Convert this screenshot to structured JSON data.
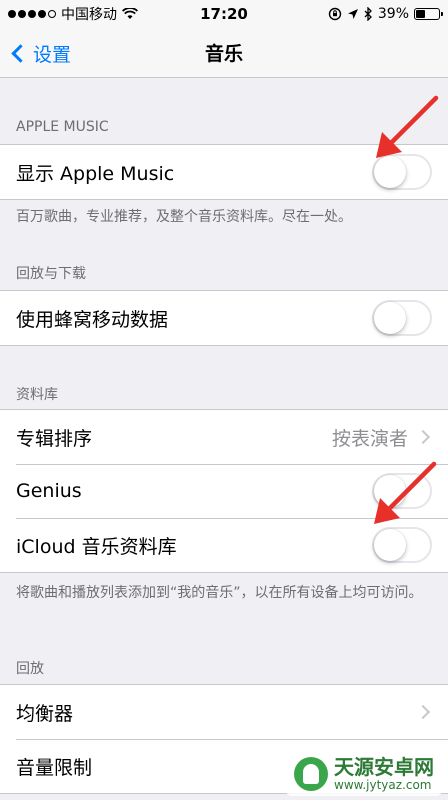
{
  "status_bar": {
    "carrier": "中国移动",
    "time": "17:20",
    "battery_percent": "39%",
    "battery_level": 0.39,
    "icons": [
      "signal-dots-icon",
      "wifi-icon",
      "rotation-lock-icon",
      "location-icon",
      "bluetooth-icon",
      "battery-icon"
    ]
  },
  "nav": {
    "back_label": "设置",
    "title": "音乐"
  },
  "sections": {
    "apple_music": {
      "header": "APPLE MUSIC",
      "show_apple_music": {
        "label": "显示 Apple Music",
        "on": false
      },
      "footer": "百万歌曲，专业推荐，及整个音乐资料库。尽在一处。"
    },
    "playback_download": {
      "header": "回放与下载",
      "cellular": {
        "label": "使用蜂窝移动数据",
        "on": false
      }
    },
    "library": {
      "header": "资料库",
      "sort_albums": {
        "label": "专辑排序",
        "value": "按表演者"
      },
      "genius": {
        "label": "Genius",
        "on": false
      },
      "icloud_library": {
        "label": "iCloud 音乐资料库",
        "on": false
      },
      "footer": "将歌曲和播放列表添加到“我的音乐”，以在所有设备上均可访问。"
    },
    "playback": {
      "header": "回放",
      "equalizer": {
        "label": "均衡器"
      },
      "volume_limit": {
        "label": "音量限制"
      }
    }
  },
  "colors": {
    "accent": "#007aff",
    "annotation_arrow": "#e8302a",
    "background": "#efeff4"
  },
  "watermark": {
    "title": "天源安卓网",
    "url": "www.jytyaz.com"
  }
}
